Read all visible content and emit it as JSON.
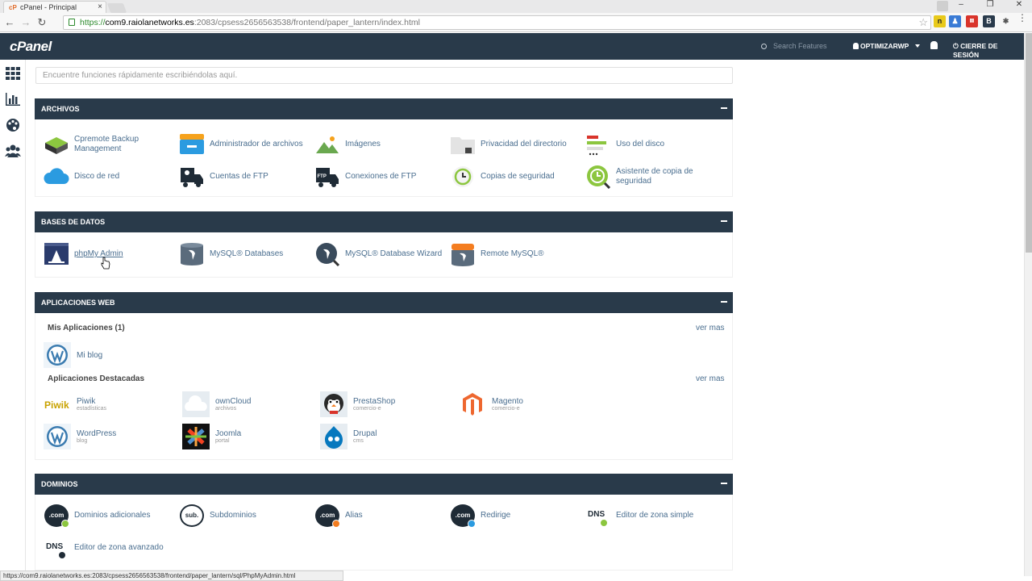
{
  "browser": {
    "tab_title": "cPanel - Principal",
    "tab_close": "×",
    "url_https": "https://",
    "url_host": "com9.raiolanetworks.es",
    "url_path": ":2083/cpsess2656563538/frontend/paper_lantern/index.html",
    "window_controls": [
      "‒",
      "❐",
      "✕"
    ],
    "status_url": "https://com9.raiolanetworks.es:2083/cpsess2656563538/frontend/paper_lantern/sql/PhpMyAdmin.html"
  },
  "header": {
    "logo": "cPanel",
    "search_placeholder": "Search Features",
    "user": "OPTIMIZARWP",
    "logout": "CIERRE DE SESIÓN"
  },
  "quick_search": {
    "placeholder": "Encuentre funciones rápidamente escribiéndolas aquí."
  },
  "sections": {
    "archivos": {
      "title": "ARCHIVOS",
      "items": [
        "Cpremote Backup Management",
        "Administrador de archivos",
        "Imágenes",
        "Privacidad del directorio",
        "Uso del disco",
        "Disco de red",
        "Cuentas de FTP",
        "Conexiones de FTP",
        "Copias de seguridad",
        "Asistente de copia de seguridad"
      ]
    },
    "bases": {
      "title": "BASES DE DATOS",
      "items": [
        "phpMy Admin",
        "MySQL® Databases",
        "MySQL® Database Wizard",
        "Remote MySQL®"
      ]
    },
    "aplicaciones": {
      "title": "APLICACIONES WEB",
      "mis_apps": "Mis Aplicaciones (1)",
      "ver_mas_1": "ver mas",
      "mi_blog": "Mi blog",
      "destacadas": "Aplicaciones Destacadas",
      "ver_mas_2": "ver mas",
      "apps": [
        {
          "name": "Piwik",
          "sub": "estadísticas"
        },
        {
          "name": "ownCloud",
          "sub": "archivos"
        },
        {
          "name": "PrestaShop",
          "sub": "comercio-e"
        },
        {
          "name": "Magento",
          "sub": "comercio-e"
        },
        {
          "name": "WordPress",
          "sub": "blog"
        },
        {
          "name": "Joomla",
          "sub": "portal"
        },
        {
          "name": "Drupal",
          "sub": "cms"
        }
      ]
    },
    "dominios": {
      "title": "DOMINIOS",
      "items": [
        "Dominios adicionales",
        "Subdominios",
        "Alias",
        "Redirige",
        "Editor de zona simple",
        "Editor de zona avanzado"
      ]
    }
  },
  "icon_text": {
    "com": ".com",
    "sub": "sub.",
    "dns": "DNS",
    "ftp": "FTP",
    "piwik": "Piwik"
  },
  "colors": {
    "header_bg": "#293a4a",
    "link": "#4a6e8f",
    "accent_green": "#8cc63f",
    "accent_orange": "#f47d20"
  }
}
